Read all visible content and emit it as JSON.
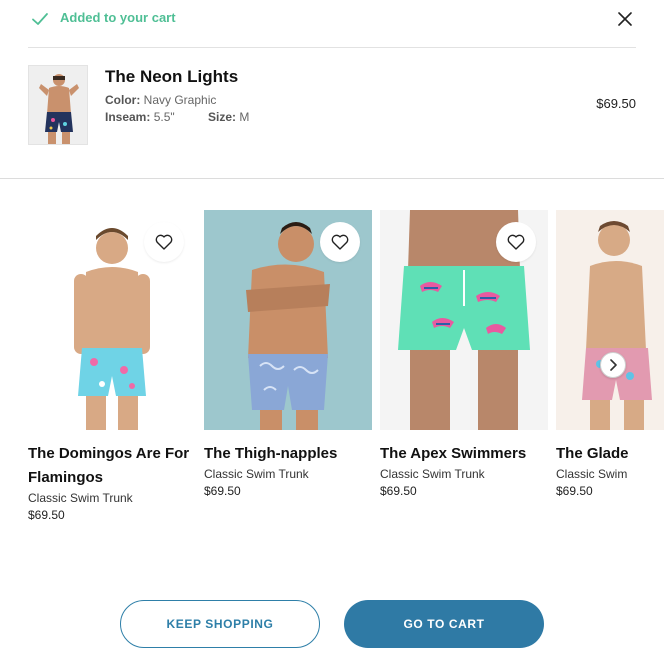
{
  "banner": {
    "message": "Added to your cart",
    "accent_color": "#4fbf95",
    "icons": [
      "check-icon",
      "close-icon"
    ]
  },
  "cart_item": {
    "name": "The Neon Lights",
    "color_label": "Color:",
    "color_value": "Navy Graphic",
    "inseam_label": "Inseam:",
    "inseam_value": "5.5\"",
    "size_label": "Size:",
    "size_value": "M",
    "price": "$69.50"
  },
  "recommendations": [
    {
      "title": "The Domingos Are For Flamingos",
      "subtitle": "Classic Swim Trunk",
      "price": "$69.50",
      "bg": "#ffffff",
      "trunk_color": "#6fd3e6",
      "skin": "#d8a985"
    },
    {
      "title": "The Thigh-napples",
      "subtitle": "Classic Swim Trunk",
      "price": "$69.50",
      "bg": "#9dc7cd",
      "trunk_color": "#8aa7d6",
      "skin": "#c98f68"
    },
    {
      "title": "The Apex Swimmers",
      "subtitle": "Classic Swim Trunk",
      "price": "$69.50",
      "bg": "#f4f4f4",
      "trunk_color": "#5fe0b6",
      "skin": "#b8876a"
    },
    {
      "title": "The Glade",
      "subtitle": "Classic Swim",
      "price": "$69.50",
      "bg": "#f7f0ea",
      "trunk_color": "#e29ab0",
      "skin": "#d7aa86"
    }
  ],
  "buttons": {
    "keep_shopping": "KEEP SHOPPING",
    "go_to_cart": "GO TO CART",
    "primary_color": "#2f7aa5"
  }
}
